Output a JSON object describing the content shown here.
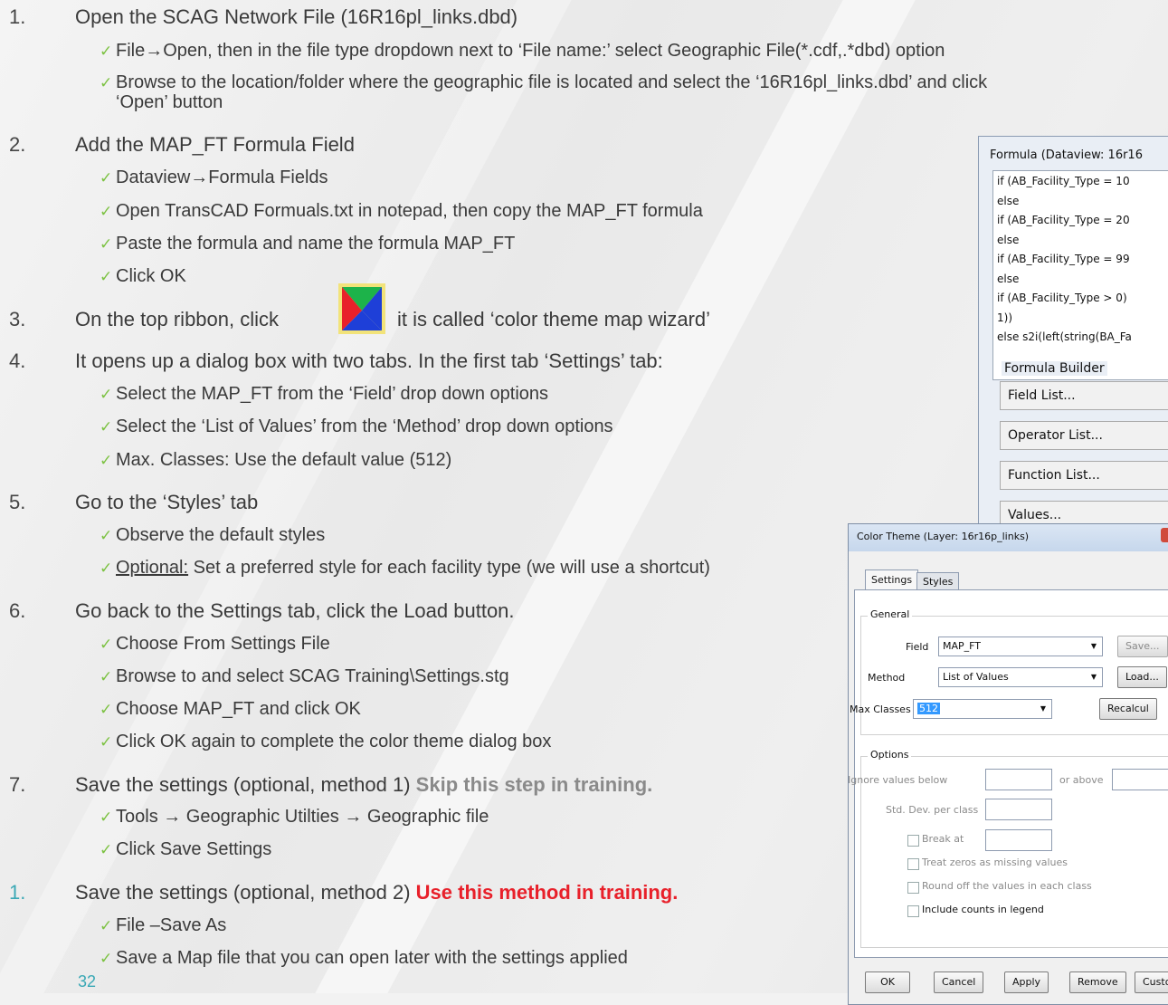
{
  "steps": [
    {
      "num": "1.",
      "text": "Open the SCAG Network File (16R16pl_links.dbd)"
    },
    {
      "sub": "File→Open, then in the file type dropdown next to ‘File name:’ select Geographic File(*.cdf,.*dbd) option"
    },
    {
      "sub": "Browse to the location/folder where the geographic file is located and select the ‘16R16pl_links.dbd’ and click",
      "sub_cont": "‘Open’ button"
    },
    {
      "num": "2.",
      "text": "Add the MAP_FT Formula Field"
    },
    {
      "sub": "Dataview→Formula Fields"
    },
    {
      "sub": "Open TransCAD Formuals.txt in notepad, then copy the MAP_FT formula"
    },
    {
      "sub": "Paste the formula and name the formula MAP_FT"
    },
    {
      "sub": "Click OK"
    },
    {
      "num": "3.",
      "text_a": "On the top ribbon, click",
      "text_b": "it is called ‘color theme map wizard’"
    },
    {
      "num": "4.",
      "text": "It opens up a dialog box with two tabs.  In the first tab ‘Settings’ tab:"
    },
    {
      "sub": "Select the MAP_FT from the ‘Field’ drop down options"
    },
    {
      "sub": "Select the ‘List of Values’ from the ‘Method’ drop down options"
    },
    {
      "sub": "Max. Classes: Use the default value (512)"
    },
    {
      "num": "5.",
      "text": "Go to the ‘Styles’ tab"
    },
    {
      "sub": "Observe the default styles"
    },
    {
      "sub_u": "Optional:",
      "sub": " Set a preferred style for each facility type (we will use a shortcut)"
    },
    {
      "num": "6.",
      "text": "Go back to the Settings tab, click the Load button."
    },
    {
      "sub": "Choose From Settings File"
    },
    {
      "sub": "Browse to and select SCAG Training\\Settings.stg"
    },
    {
      "sub": "Choose MAP_FT and click OK"
    },
    {
      "sub": "Click OK again to complete the color theme dialog box"
    },
    {
      "num": "7.",
      "text": "Save the settings (optional, method 1) ",
      "emph": "Skip this step in training."
    },
    {
      "sub": "Tools → Geographic Utilties → Geographic file"
    },
    {
      "sub": "Click Save Settings"
    },
    {
      "num": "1.",
      "text": "Save the settings (optional, method 2) ",
      "emph": "Use this method in training."
    },
    {
      "sub": "File –Save As"
    },
    {
      "sub": "Save a Map file that you can open later with the settings applied"
    }
  ],
  "check_glyph": "✓",
  "page_number": "32",
  "formula_dialog": {
    "title": "Formula (Dataview: 16r16",
    "lines": [
      "if (AB_Facility_Type = 10",
      "else",
      "if (AB_Facility_Type = 20",
      "else",
      "if (AB_Facility_Type = 99",
      "else",
      "if (AB_Facility_Type > 0)",
      "1))",
      "else s2i(left(string(BA_Fa"
    ],
    "builder_label": "Formula Builder",
    "buttons": [
      "Field List...",
      "Operator List...",
      "Function List...",
      "Values..."
    ]
  },
  "color_theme_dialog": {
    "title": "Color Theme (Layer: 16r16p_links)",
    "tabs": [
      "Settings",
      "Styles"
    ],
    "general_label": "General",
    "field_label": "Field",
    "field_value": "MAP_FT",
    "method_label": "Method",
    "method_value": "List of Values",
    "max_classes_label": "Max Classes",
    "max_classes_value": "512",
    "save_btn": "Save...",
    "load_btn": "Load...",
    "recalc_btn": "Recalcul",
    "options_label": "Options",
    "ignore_label": "Ignore values below",
    "or_above_label": "or above",
    "stddev_label": "Std. Dev. per class",
    "break_at_label": "Break at",
    "treat_zeros_label": "Treat zeros as missing values",
    "round_off_label": "Round off the values in each class",
    "include_counts_label": "Include counts in legend",
    "ok_btn": "OK",
    "cancel_btn": "Cancel",
    "apply_btn": "Apply",
    "remove_btn": "Remove",
    "custom_btn": "Custo"
  },
  "colors": {
    "check": "#7cc242",
    "teal": "#3aa8b5",
    "red": "#e8202a"
  }
}
